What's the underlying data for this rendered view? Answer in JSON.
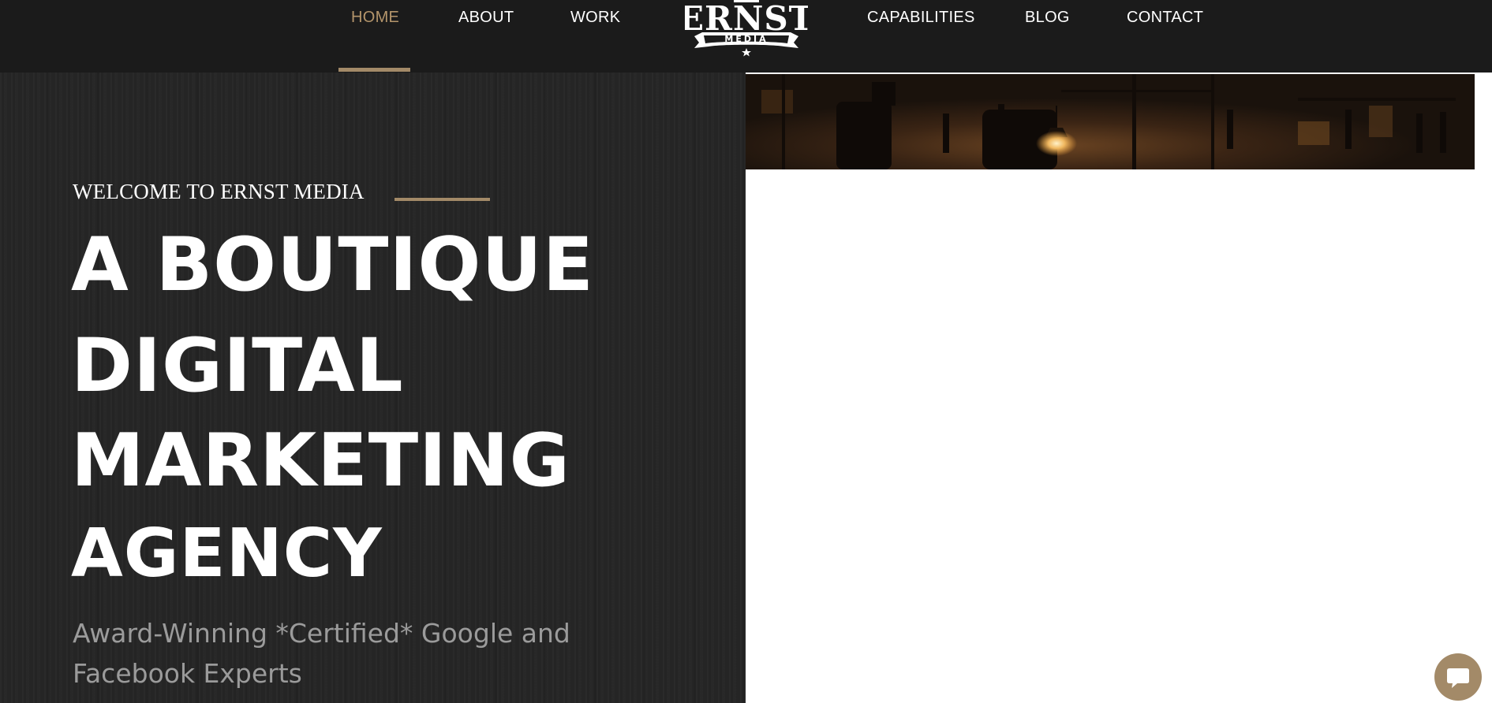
{
  "nav": {
    "items": [
      {
        "label": "HOME",
        "active": true
      },
      {
        "label": "ABOUT",
        "active": false
      },
      {
        "label": "WORK",
        "active": false
      },
      {
        "label": "CAPABILITIES",
        "active": false
      },
      {
        "label": "BLOG",
        "active": false
      },
      {
        "label": "CONTACT",
        "active": false
      }
    ],
    "logo": {
      "line1": "ERNST",
      "line2": "MEDIA"
    }
  },
  "hero": {
    "welcome": "WELCOME TO ERNST MEDIA",
    "headline": [
      "A BOUTIQUE",
      "DIGITAL",
      "MARKETING",
      "AGENCY"
    ],
    "subtitle": "Award-Winning *Certified* Google and Facebook Experts"
  },
  "chat": {
    "icon": "chat-bubble-icon"
  },
  "colors": {
    "nav_background": "#1b1b1b",
    "accent": "#a38a68",
    "active_link": "#b4956b",
    "hero_background": "#262626",
    "subtitle_text": "#9b9b9b"
  }
}
